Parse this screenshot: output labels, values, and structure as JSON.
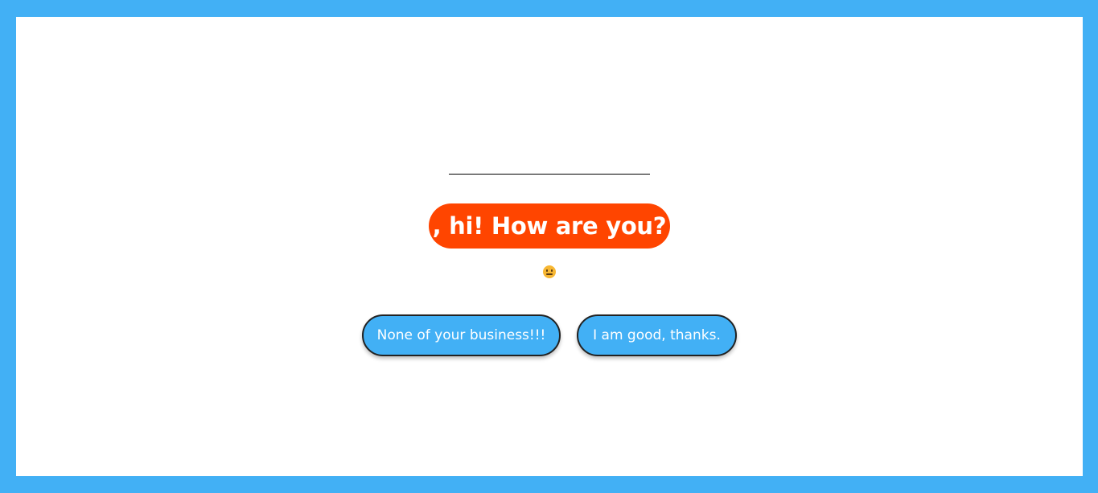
{
  "name_input": {
    "value": "",
    "placeholder": ""
  },
  "greeting": {
    "text": ", hi! How are you?"
  },
  "mood_emoji": {
    "icon": "neutral-face-icon"
  },
  "replies": [
    {
      "label": "None of your business!!!"
    },
    {
      "label": "I am good, thanks."
    }
  ],
  "colors": {
    "frame": "#42b0f5",
    "greeting_bg": "#ff4500",
    "button_bg": "#42b0f5"
  }
}
